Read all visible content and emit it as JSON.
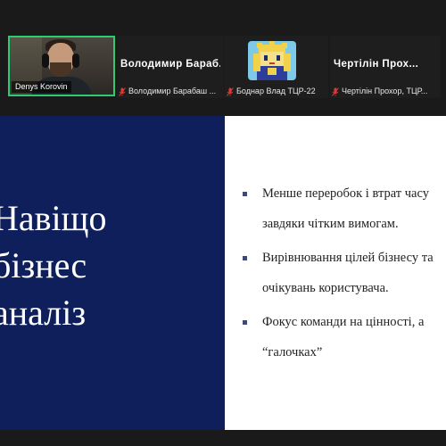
{
  "participants": [
    {
      "kind": "video",
      "name": "Denys Korovin"
    },
    {
      "kind": "name",
      "display_name": "Володимир  Бараб...",
      "sub_label": "Володимир Барабаш ..."
    },
    {
      "kind": "avatar",
      "sub_label": "Боднар Влад ТЦР-22"
    },
    {
      "kind": "name",
      "display_name": "Чертілін  Прох...",
      "sub_label": "Чертілін Прохор, ТЦР..."
    }
  ],
  "slide": {
    "title_lines": [
      "Навіщо",
      "бізнес",
      "аналіз"
    ],
    "bullets": [
      {
        "lines": [
          "Менше переробок і втрат часу",
          "завдяки чітким вимогам."
        ]
      },
      {
        "lines": [
          "Вирівнювання цілей бізнесу та",
          "очікувань користувача."
        ]
      },
      {
        "lines": [
          " Фокус команди на цінності, а",
          "“галочках”"
        ]
      }
    ]
  },
  "colors": {
    "slide_left_bg": "#0f1f5c",
    "speaker_border": "#2ecc71",
    "mute": "#e53935"
  }
}
